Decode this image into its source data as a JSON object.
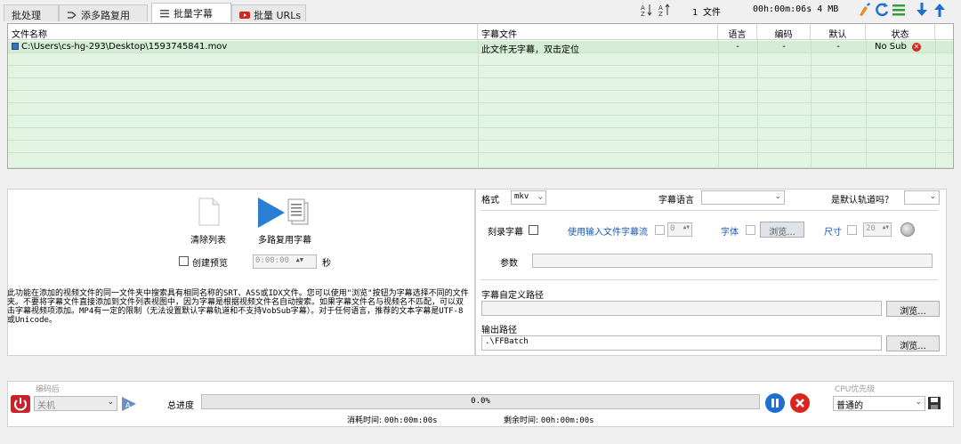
{
  "tabs": [
    {
      "label": "批处理",
      "icon": "none"
    },
    {
      "label": "添多路复用",
      "icon": "merge-icon"
    },
    {
      "label": "批量字幕",
      "icon": "list-icon"
    },
    {
      "label": "批量 URLs",
      "icon": "youtube-icon"
    }
  ],
  "toolbar": {
    "file_count": "1 文件",
    "duration_size": "00h:00m:06s 4 MB",
    "sort_az_icon": "sort-az-icon",
    "sort_za_icon": "sort-za-icon",
    "colors": {
      "clear": "#e0902a",
      "refresh": "#1f6fd1",
      "list": "#2e9e3a",
      "arrow": "#1f6fd1"
    }
  },
  "table": {
    "headers": {
      "filename": "文件名称",
      "subfile": "字幕文件",
      "lang": "语言",
      "enc": "编码",
      "default": "默认",
      "status": "状态"
    },
    "rows": [
      {
        "filename": "C:\\Users\\cs-hg-293\\Desktop\\1593745841.mov",
        "subfile": "此文件无字幕，双击定位",
        "lang": "-",
        "enc": "-",
        "default": "-",
        "status": "No Sub"
      }
    ]
  },
  "left_panel": {
    "clear_label": "清除列表",
    "mux_label": "多路复用字幕",
    "preview_label": "创建预览",
    "preview_time": "0:00:00",
    "seconds_label": "秒",
    "info_text": "此功能在添加的视频文件的同一文件夹中搜索具有相同名称的SRT、ASS或IDX文件。您可以使用\"浏览\"按钮为字幕选择不同的文件夹。不要将字幕文件直接添加到文件列表视图中，因为字幕是根据视频文件名自动搜索。如果字幕文件名与视频名不匹配，可以双击字幕视频项添加。MP4有一定的限制（无法设置默认字幕轨道和不支持VobSub字幕）。对于任何语言，推荐的文本字幕是UTF-8或Unicode。"
  },
  "right_panel": {
    "format_label": "格式",
    "format_value": "mkv",
    "sub_lang_label": "字幕语言",
    "sub_lang_value": "",
    "default_track_label": "是默认轨道吗？",
    "default_track_value": "",
    "burn_label": "刻录字幕",
    "use_input_label": "使用输入文件字幕流",
    "use_input_value": "0",
    "font_label": "字体",
    "browse_font": "浏览...",
    "size_label": "尺寸",
    "size_value": "20",
    "params_label": "参数",
    "params_value": "",
    "custom_path_label": "字幕自定义路径",
    "custom_path_value": "",
    "browse1": "浏览...",
    "output_label": "输出路径",
    "output_value": ".\\FFBatch",
    "browse2": "浏览..."
  },
  "bottom": {
    "after_encode_label": "编码后",
    "after_encode_value": "关机",
    "total_progress_label": "总进度",
    "progress_value": "0.0%",
    "progress_fraction": 0,
    "elapsed_label": "消耗时间:",
    "elapsed_value": "00h:00m:00s",
    "remaining_label": "剩余时间:",
    "remaining_value": "00h:00m:00s",
    "cpu_label": "CPU优先级",
    "cpu_value": "普通的"
  }
}
